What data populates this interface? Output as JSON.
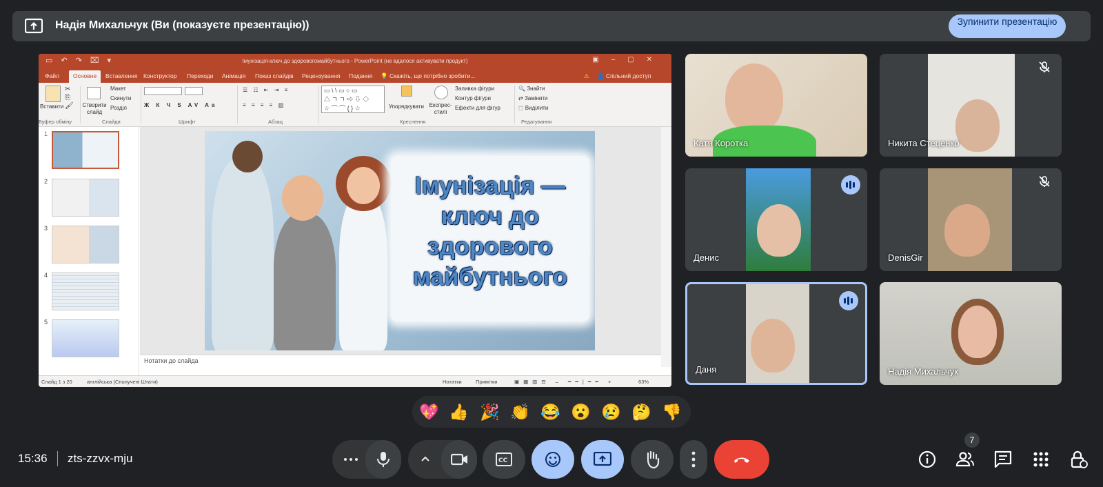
{
  "banner": {
    "title": "Надія Михальчук (Ви (показуєте презентацію))",
    "stop_button": "Зупинити презентацію"
  },
  "ppt": {
    "window_title": "Імунізація-ключ до здоровогомайбутнього - PowerPoint (не вдалося активувати продукт)",
    "tabs": [
      "Файл",
      "Основне",
      "Вставлення",
      "Конструктор",
      "Переходи",
      "Анімація",
      "Показ слайдів",
      "Рецензування",
      "Подання"
    ],
    "tell_me": "Скажіть, що потрібно зробити...",
    "share": "Спільний доступ",
    "ribbon": {
      "paste": "Вставити",
      "clipboard": "Буфер обміну",
      "new_slide": "Створити слайд",
      "layout": "Макет",
      "reset": "Скинути",
      "section": "Розділ",
      "slides": "Слайди",
      "font": "Шрифт",
      "paragraph": "Абзац",
      "arrange": "Упорядкувати",
      "quick_styles": "Експрес-стилі",
      "shape_fill": "Заливка фігури",
      "shape_outline": "Контур фігури",
      "shape_effects": "Ефекти для фігур",
      "drawing": "Креслення",
      "find": "Знайти",
      "replace": "Замінити",
      "select": "Виділити",
      "editing": "Редагування"
    },
    "slide_numbers": [
      "1",
      "2",
      "3",
      "4",
      "5"
    ],
    "slide_title_lines": [
      "Імунізація —",
      "ключ до",
      "здорового",
      "майбутнього"
    ],
    "notes_placeholder": "Нотатки до слайда",
    "status": {
      "slide_count": "Слайд 1 з 20",
      "language": "англійська (Сполучені Штати)",
      "notes": "Нотатки",
      "comments": "Примітки",
      "zoom": "63%"
    }
  },
  "participants": [
    {
      "name": "Катя Коротка"
    },
    {
      "name": "Никита Стеценко"
    },
    {
      "name": "Денис"
    },
    {
      "name": "DenisGir"
    },
    {
      "name": "Даня"
    },
    {
      "name": "Надія Михальчук"
    }
  ],
  "reactions": [
    "💖",
    "👍",
    "🎉",
    "👏",
    "😂",
    "😮",
    "😢",
    "🤔",
    "👎"
  ],
  "bottom": {
    "time": "15:36",
    "meeting_code": "zts-zzvx-mju",
    "people_count": "7"
  },
  "colors": {
    "ppt_accent": "#b7472a",
    "button_accent": "#a8c7fa",
    "end_call": "#ea4335"
  }
}
